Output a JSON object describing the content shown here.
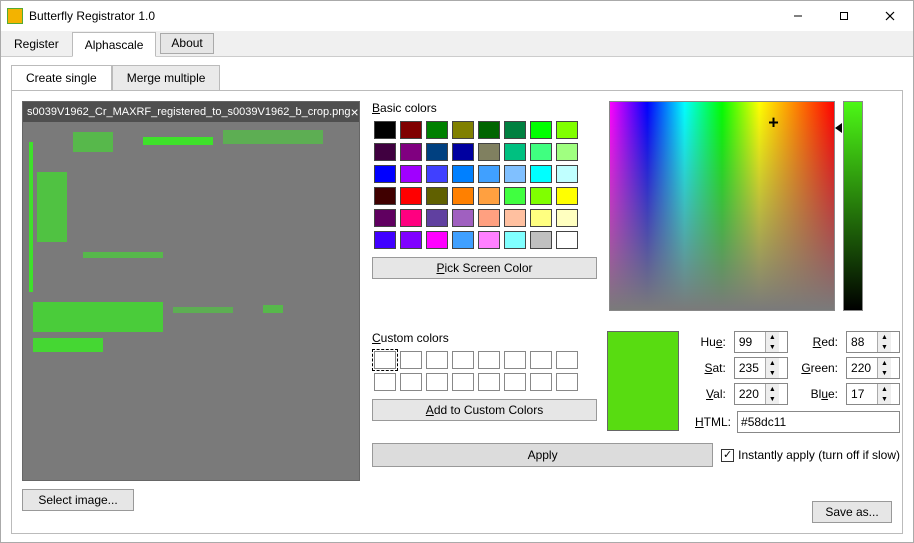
{
  "window": {
    "title": "Butterfly Registrator 1.0"
  },
  "menubar": {
    "register": "Register",
    "alphascale": "Alphascale",
    "about": "About"
  },
  "subtabs": {
    "create_single": "Create single",
    "merge_multiple": "Merge multiple"
  },
  "preview": {
    "filename": "s0039V1962_Cr_MAXRF_registered_to_s0039V1962_b_crop.png"
  },
  "picker": {
    "basic_colors_label_pre": "B",
    "basic_colors_label_rest": "asic colors",
    "pick_screen_label_pre": "P",
    "pick_screen_label_rest": "ick Screen Color",
    "custom_colors_label_pre": "C",
    "custom_colors_label_rest": "ustom colors",
    "add_custom_label_pre": "A",
    "add_custom_label_rest": "dd to Custom Colors",
    "swatches": [
      "#000000",
      "#800000",
      "#008000",
      "#808000",
      "#006500",
      "#008040",
      "#00ff00",
      "#80ff00",
      "#400040",
      "#800080",
      "#004080",
      "#0000a0",
      "#808060",
      "#00c080",
      "#40ff80",
      "#a0ff80",
      "#0000ff",
      "#a000ff",
      "#4040ff",
      "#0080ff",
      "#40a0ff",
      "#80c0ff",
      "#00ffff",
      "#c0ffff",
      "#400000",
      "#ff0000",
      "#606000",
      "#ff8000",
      "#ffa040",
      "#40ff40",
      "#80ff00",
      "#ffff00",
      "#600060",
      "#ff0080",
      "#6040a0",
      "#a060c0",
      "#ffa080",
      "#ffc0a0",
      "#ffff80",
      "#ffffc0",
      "#4000ff",
      "#8000ff",
      "#ff00ff",
      "#40a0ff",
      "#ff80ff",
      "#80ffff",
      "#c0c0c0",
      "#ffffff"
    ]
  },
  "values": {
    "hue_label": "Hue:",
    "hue_u": "e",
    "hue": "99",
    "sat_label": "Sat:",
    "sat_u": "S",
    "sat": "235",
    "val_label": "Val:",
    "val_u": "V",
    "val": "220",
    "red_label": "Red:",
    "red_u": "R",
    "red": "88",
    "green_label": "Green:",
    "green_u": "G",
    "green": "220",
    "blue_label": "Blue:",
    "blue_u": "u",
    "blue": "17",
    "html_label": "HTML:",
    "html_u": "H",
    "html_pre": "#",
    "html": "#58dc11"
  },
  "bottom": {
    "apply": "Apply",
    "instant_label": "Instantly apply (turn off if slow)",
    "instant_checked": "✓",
    "select_image": "Select image...",
    "save_as": "Save as..."
  }
}
